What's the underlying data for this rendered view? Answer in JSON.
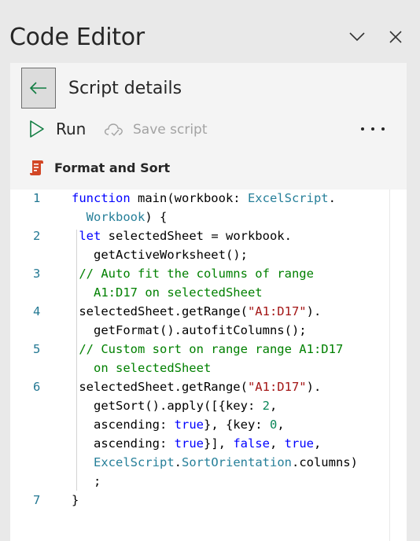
{
  "header": {
    "title": "Code Editor",
    "collapse_icon": "chevron-down-icon",
    "close_icon": "close-icon"
  },
  "details": {
    "back_icon": "arrow-left-icon",
    "title": "Script details"
  },
  "toolbar": {
    "run_label": "Run",
    "run_icon": "play-icon",
    "save_label": "Save script",
    "save_icon": "cloud-save-icon",
    "more_icon": "more-options-icon"
  },
  "script": {
    "name": "Format and Sort",
    "icon": "script-icon",
    "icon_color": "#d24726"
  },
  "colors": {
    "keyword": "#0000ff",
    "type": "#267f99",
    "comment": "#008000",
    "string": "#a31515",
    "number": "#098658",
    "line_number": "#237893"
  },
  "code": {
    "line_numbers": [
      "1",
      "2",
      "3",
      "4",
      "5",
      "6",
      "7"
    ],
    "lines": [
      [
        {
          "t": "kw",
          "v": "function"
        },
        {
          "t": "tx",
          "v": " main(workbook: "
        },
        {
          "t": "tp",
          "v": "ExcelScript"
        },
        {
          "t": "tx",
          "v": "."
        }
      ],
      [
        {
          "t": "tx",
          "v": "  "
        },
        {
          "t": "tp",
          "v": "Workbook"
        },
        {
          "t": "tx",
          "v": ") {"
        }
      ],
      [
        {
          "t": "tx",
          "v": " "
        },
        {
          "t": "kw",
          "v": "let"
        },
        {
          "t": "tx",
          "v": " selectedSheet = workbook."
        }
      ],
      [
        {
          "t": "tx",
          "v": "   getActiveWorksheet();"
        }
      ],
      [
        {
          "t": "cm",
          "v": " // Auto fit the columns of range"
        }
      ],
      [
        {
          "t": "cm",
          "v": "   A1:D17 on selectedSheet"
        }
      ],
      [
        {
          "t": "tx",
          "v": " selectedSheet.getRange("
        },
        {
          "t": "st",
          "v": "\"A1:D17\""
        },
        {
          "t": "tx",
          "v": ")."
        }
      ],
      [
        {
          "t": "tx",
          "v": "   getFormat().autofitColumns();"
        }
      ],
      [
        {
          "t": "cm",
          "v": " // Custom sort on range range A1:D17"
        }
      ],
      [
        {
          "t": "cm",
          "v": "   on selectedSheet"
        }
      ],
      [
        {
          "t": "tx",
          "v": " selectedSheet.getRange("
        },
        {
          "t": "st",
          "v": "\"A1:D17\""
        },
        {
          "t": "tx",
          "v": ")."
        }
      ],
      [
        {
          "t": "tx",
          "v": "   getSort().apply([{key: "
        },
        {
          "t": "nm",
          "v": "2"
        },
        {
          "t": "tx",
          "v": ","
        }
      ],
      [
        {
          "t": "tx",
          "v": "   ascending: "
        },
        {
          "t": "kw",
          "v": "true"
        },
        {
          "t": "tx",
          "v": "}, {key: "
        },
        {
          "t": "nm",
          "v": "0"
        },
        {
          "t": "tx",
          "v": ","
        }
      ],
      [
        {
          "t": "tx",
          "v": "   ascending: "
        },
        {
          "t": "kw",
          "v": "true"
        },
        {
          "t": "tx",
          "v": "}], "
        },
        {
          "t": "kw",
          "v": "false"
        },
        {
          "t": "tx",
          "v": ", "
        },
        {
          "t": "kw",
          "v": "true"
        },
        {
          "t": "tx",
          "v": ","
        }
      ],
      [
        {
          "t": "tx",
          "v": "   "
        },
        {
          "t": "tp",
          "v": "ExcelScript"
        },
        {
          "t": "tx",
          "v": "."
        },
        {
          "t": "tp",
          "v": "SortOrientation"
        },
        {
          "t": "tx",
          "v": ".columns)"
        }
      ],
      [
        {
          "t": "tx",
          "v": "   ;"
        }
      ],
      [
        {
          "t": "tx",
          "v": "}"
        }
      ]
    ],
    "line_number_rows": [
      0,
      2,
      4,
      6,
      8,
      10,
      16
    ]
  }
}
